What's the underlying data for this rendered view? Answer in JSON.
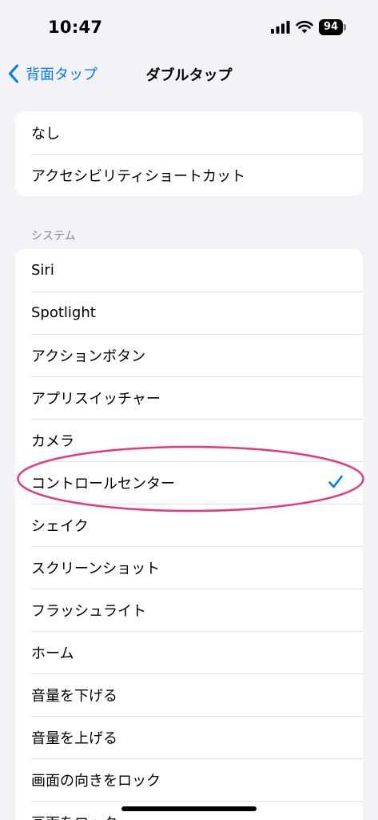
{
  "status_bar": {
    "time": "10:47",
    "battery": "94"
  },
  "nav": {
    "back_label": "背面タップ",
    "title": "ダブルタップ"
  },
  "group1": {
    "items": [
      "なし",
      "アクセシビリティショートカット"
    ]
  },
  "system": {
    "header": "システム",
    "items": [
      "Siri",
      "Spotlight",
      "アクションボタン",
      "アプリスイッチャー",
      "カメラ",
      "コントロールセンター",
      "シェイク",
      "スクリーンショット",
      "フラッシュライト",
      "ホーム",
      "音量を下げる",
      "音量を上げる",
      "画面の向きをロック",
      "画面をロック"
    ],
    "selected": "コントロールセンター"
  },
  "colors": {
    "accent": "#007aff",
    "annotation": "#e6397a"
  },
  "icons": {
    "back": "chevron-left-icon",
    "check": "checkmark-icon"
  }
}
